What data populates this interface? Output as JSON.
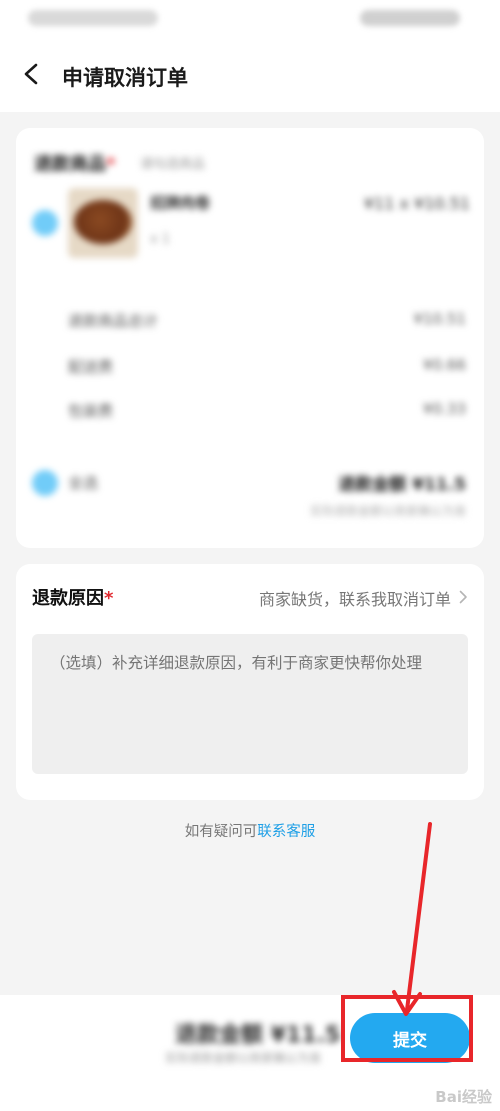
{
  "header": {
    "title": "申请取消订单"
  },
  "goods": {
    "title": "退款商品",
    "required_mark": "*",
    "subtitle": "请勾选商品",
    "item_name": "招牌肉卷",
    "item_qty": "x 1",
    "item_price": "¥11 x ¥10.51",
    "fees": [
      {
        "label": "退款商品总计",
        "value": "¥10.51"
      },
      {
        "label": "配送费",
        "value": "¥0.66"
      },
      {
        "label": "包装费",
        "value": "¥0.33"
      }
    ],
    "all_label": "全选",
    "refund_total": "退款金额 ¥11.5",
    "refund_note": "实际退款金额以商家确认为准"
  },
  "reason": {
    "title": "退款原因",
    "required_mark": "*",
    "selected": "商家缺货，联系我取消订单",
    "placeholder": "（选填）补充详细退款原因，有利于商家更快帮你处理"
  },
  "contact": {
    "prefix": "如有疑问可",
    "link": "联系客服"
  },
  "bottom": {
    "amount": "退款金额 ¥11.5",
    "note": "实际退款金额以商家确认为准",
    "submit_label": "提交"
  },
  "watermark": "Bai经验"
}
